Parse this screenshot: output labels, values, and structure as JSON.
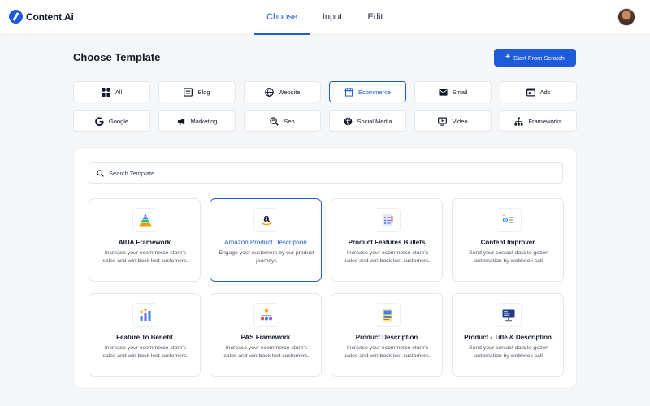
{
  "app": {
    "logo_text": "Content.Ai"
  },
  "nav": {
    "tabs": [
      "Choose",
      "Input",
      "Edit"
    ],
    "active_tab": "Choose"
  },
  "header": {
    "title": "Choose Template",
    "start_button": "Start From Scratch"
  },
  "categories": [
    {
      "label": "All",
      "icon": "grid-icon",
      "active": false
    },
    {
      "label": "Blog",
      "icon": "blog-icon",
      "active": false
    },
    {
      "label": "Website",
      "icon": "globe-icon",
      "active": false
    },
    {
      "label": "Ecommerce",
      "icon": "store-icon",
      "active": true
    },
    {
      "label": "Email",
      "icon": "email-icon",
      "active": false
    },
    {
      "label": "Ads",
      "icon": "ads-icon",
      "active": false
    },
    {
      "label": "Google",
      "icon": "google-icon",
      "active": false
    },
    {
      "label": "Marketing",
      "icon": "megaphone-icon",
      "active": false
    },
    {
      "label": "Seo",
      "icon": "seo-icon",
      "active": false
    },
    {
      "label": "Social Media",
      "icon": "social-icon",
      "active": false
    },
    {
      "label": "Video",
      "icon": "video-icon",
      "active": false
    },
    {
      "label": "Frameworks",
      "icon": "frameworks-icon",
      "active": false
    }
  ],
  "search": {
    "placeholder": "Search Template"
  },
  "templates": [
    {
      "title": "AIDA Framework",
      "description": "Increase your ecommerce store's sales and win back lost customers.",
      "icon": "pyramid-icon",
      "active": false
    },
    {
      "title": "Amazon Product Description",
      "description": "Engage your customers by our product journeys",
      "icon": "amazon-icon",
      "active": true
    },
    {
      "title": "Product Features Bullets",
      "description": "Increase your ecommerce store's sales and win back lost customers.",
      "icon": "bullet-list-icon",
      "active": false
    },
    {
      "title": "Content Improver",
      "description": "Send your contact data to gozen automation by webhook call",
      "icon": "content-improver-icon",
      "active": false
    },
    {
      "title": "Feature To Benefit",
      "description": "Increase your ecommerce store's sales and win back lost customers.",
      "icon": "growth-arrows-icon",
      "active": false
    },
    {
      "title": "PAS Framework",
      "description": "Increase your ecommerce store's sales and win back lost customers.",
      "icon": "hierarchy-icon",
      "active": false
    },
    {
      "title": "Product Description",
      "description": "Increase your ecommerce store's sales and win back lost customers.",
      "icon": "document-icon",
      "active": false
    },
    {
      "title": "Product - Title & Description",
      "description": "Send your contact data to gozen automation by webhook call",
      "icon": "monitor-icon",
      "active": false
    }
  ],
  "colors": {
    "accent": "#1d5bd8",
    "background": "#f6f7f9",
    "card_border": "#e5e7eb"
  }
}
